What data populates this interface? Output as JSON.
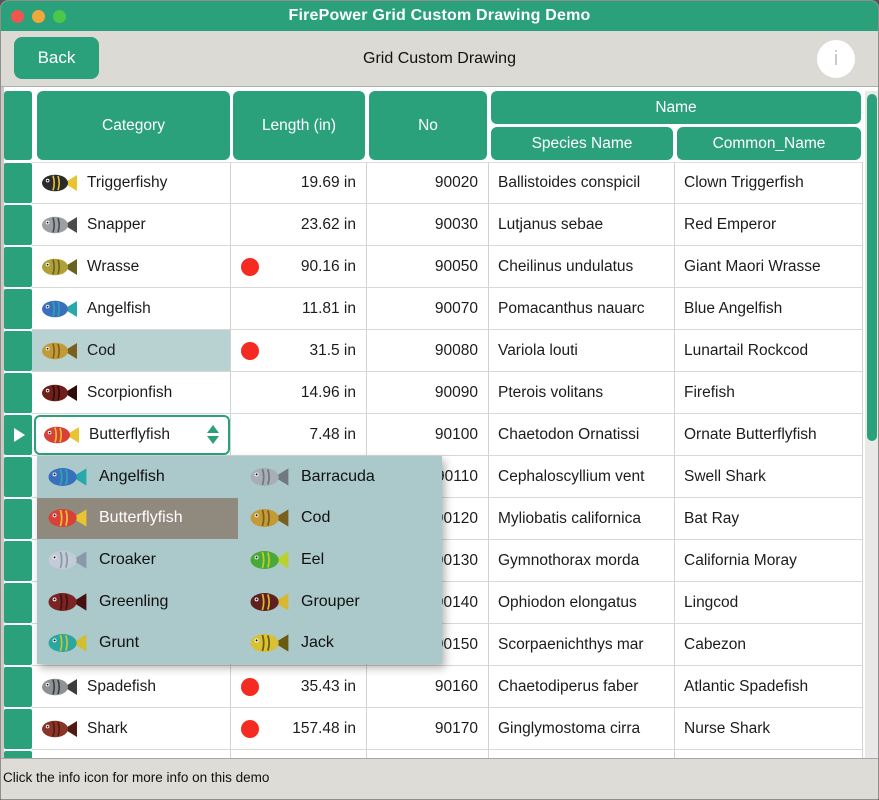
{
  "colors": {
    "accent_green": "#2ba17b",
    "titlebar_green": "#2ba17b",
    "toolbar_gray": "#dbdad5",
    "statusbar_gray": "#dedcd7",
    "selection_teal": "#b7d2d1",
    "dropdown_bg": "#abc9ca",
    "dropdown_selected_bg": "#90897e",
    "alert_red": "#f52a20"
  },
  "window": {
    "title": "FirePower Grid Custom Drawing Demo"
  },
  "toolbar": {
    "back_label": "Back",
    "title": "Grid Custom Drawing",
    "info_label": "i"
  },
  "grid": {
    "headers": {
      "category": "Category",
      "length": "Length (in)",
      "no": "No",
      "name_group": "Name",
      "species": "Species Name",
      "common": "Common_Name"
    },
    "rows": [
      {
        "category": "Triggerfishy",
        "icon": {
          "body": "#2b2b2b",
          "tail": "#e8c430"
        },
        "alert": false,
        "length": "19.69 in",
        "no": "90020",
        "species": "Ballistoides conspicil",
        "common": "Clown Triggerfish",
        "state": "normal"
      },
      {
        "category": "Snapper",
        "icon": {
          "body": "#9aa0a4",
          "tail": "#4a4a4a"
        },
        "alert": false,
        "length": "23.62 in",
        "no": "90030",
        "species": "Lutjanus sebae",
        "common": "Red Emperor",
        "state": "normal"
      },
      {
        "category": "Wrasse",
        "icon": {
          "body": "#b0a038",
          "tail": "#6a6020"
        },
        "alert": true,
        "length": "90.16 in",
        "no": "90050",
        "species": "Cheilinus undulatus",
        "common": "Giant Maori Wrasse",
        "state": "normal"
      },
      {
        "category": "Angelfish",
        "icon": {
          "body": "#3a6fc0",
          "tail": "#28a8a8"
        },
        "alert": false,
        "length": "11.81 in",
        "no": "90070",
        "species": "Pomacanthus nauarc",
        "common": "Blue Angelfish",
        "state": "normal"
      },
      {
        "category": "Cod",
        "icon": {
          "body": "#c49a36",
          "tail": "#7a5f1e"
        },
        "alert": true,
        "length": "31.5 in",
        "no": "90080",
        "species": "Variola louti",
        "common": "Lunartail Rockcod",
        "state": "selected"
      },
      {
        "category": "Scorpionfish",
        "icon": {
          "body": "#6e1f1a",
          "tail": "#2e0c0a"
        },
        "alert": false,
        "length": "14.96 in",
        "no": "90090",
        "species": "Pterois volitans",
        "common": "Firefish",
        "state": "normal"
      },
      {
        "category": "Butterflyfish",
        "icon": {
          "body": "#d84038",
          "tail": "#e8c430"
        },
        "alert": false,
        "length": "7.48 in",
        "no": "90100",
        "species": "Chaetodon Ornatissi",
        "common": "Ornate Butterflyfish",
        "state": "editing"
      },
      {
        "category": "",
        "icon": null,
        "alert": false,
        "length": "",
        "no": "90110",
        "species": "Cephaloscyllium vent",
        "common": "Swell Shark",
        "state": "normal"
      },
      {
        "category": "",
        "icon": null,
        "alert": false,
        "length": "",
        "no": "90120",
        "species": "Myliobatis californica",
        "common": "Bat Ray",
        "state": "normal"
      },
      {
        "category": "",
        "icon": null,
        "alert": false,
        "length": "",
        "no": "90130",
        "species": "Gymnothorax morda",
        "common": "California Moray",
        "state": "normal"
      },
      {
        "category": "",
        "icon": null,
        "alert": false,
        "length": "",
        "no": "90140",
        "species": "Ophiodon elongatus",
        "common": "Lingcod",
        "state": "normal"
      },
      {
        "category": "",
        "icon": null,
        "alert": false,
        "length": "",
        "no": "90150",
        "species": "Scorpaenichthys mar",
        "common": "Cabezon",
        "state": "normal"
      },
      {
        "category": "Spadefish",
        "icon": {
          "body": "#8e9296",
          "tail": "#3c3c3c"
        },
        "alert": true,
        "length": "35.43 in",
        "no": "90160",
        "species": "Chaetodiperus faber",
        "common": "Atlantic Spadefish",
        "state": "normal"
      },
      {
        "category": "Shark",
        "icon": {
          "body": "#8a3428",
          "tail": "#4e1a12"
        },
        "alert": true,
        "length": "157.48 in",
        "no": "90170",
        "species": "Ginglymostoma cirra",
        "common": "Nurse Shark",
        "state": "normal"
      }
    ]
  },
  "editor": {
    "value": "Butterflyfish",
    "icon": {
      "body": "#d84038",
      "tail": "#e8c430"
    }
  },
  "dropdown": {
    "selected": "Butterflyfish",
    "columns": [
      [
        {
          "label": "Angelfish",
          "icon": {
            "body": "#3a6fc0",
            "tail": "#28a8a8"
          }
        },
        {
          "label": "Butterflyfish",
          "icon": {
            "body": "#d84038",
            "tail": "#e8c430"
          }
        },
        {
          "label": "Croaker",
          "icon": {
            "body": "#c2cbd6",
            "tail": "#8a98a8"
          }
        },
        {
          "label": "Greenling",
          "icon": {
            "body": "#7a2424",
            "tail": "#441010"
          }
        },
        {
          "label": "Grunt",
          "icon": {
            "body": "#28a89e",
            "tail": "#d0c030"
          }
        }
      ],
      [
        {
          "label": "Barracuda",
          "icon": {
            "body": "#a8aeb6",
            "tail": "#707880"
          }
        },
        {
          "label": "Cod",
          "icon": {
            "body": "#c49a36",
            "tail": "#7a5f1e"
          }
        },
        {
          "label": "Eel",
          "icon": {
            "body": "#48a838",
            "tail": "#b8d030"
          }
        },
        {
          "label": "Grouper",
          "icon": {
            "body": "#5f1f1f",
            "tail": "#d8b830"
          }
        },
        {
          "label": "Jack",
          "icon": {
            "body": "#d8c233",
            "tail": "#6a5a10"
          }
        }
      ]
    ]
  },
  "statusbar": {
    "text": "Click the info icon for more info on this demo"
  }
}
